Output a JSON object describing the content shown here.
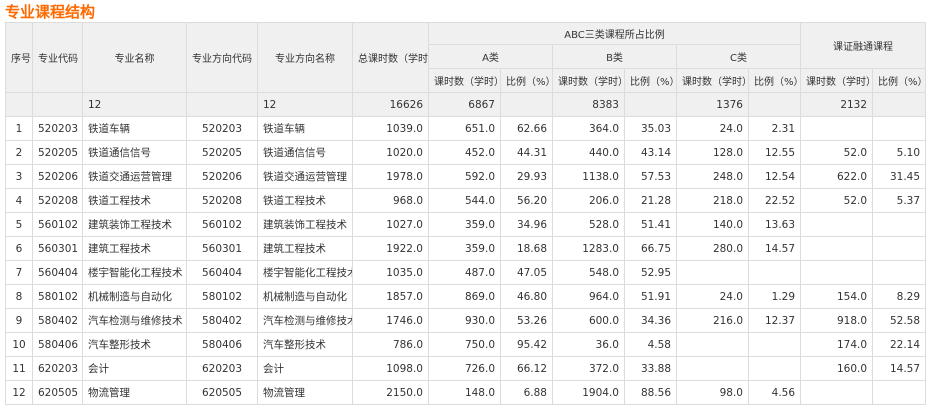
{
  "title": "专业课程结构",
  "header": {
    "seq": "序号",
    "major_code": "专业代码",
    "major_name": "专业名称",
    "dir_code": "专业方向代码",
    "dir_name": "专业方向名称",
    "total_hours": "总课时数（学时）",
    "abc_group": "ABC三类课程所占比例",
    "cert_group": "课证融通课程",
    "cat_a": "A类",
    "cat_b": "B类",
    "cat_c": "C类",
    "hours": "课时数（学时）",
    "ratio": "比例（%）"
  },
  "totals": {
    "major_name": "12",
    "dir_name": "12",
    "total_hours": "16626",
    "a_hours": "6867",
    "b_hours": "8383",
    "c_hours": "1376",
    "cert_hours": "2132"
  },
  "rows": [
    {
      "no": "1",
      "code": "520203",
      "name": "铁道车辆",
      "dcode": "520203",
      "dname": "铁道车辆",
      "total": "1039.0",
      "a_h": "651.0",
      "a_p": "62.66",
      "b_h": "364.0",
      "b_p": "35.03",
      "c_h": "24.0",
      "c_p": "2.31",
      "x_h": "",
      "x_p": ""
    },
    {
      "no": "2",
      "code": "520205",
      "name": "铁道通信信号",
      "dcode": "520205",
      "dname": "铁道通信信号",
      "total": "1020.0",
      "a_h": "452.0",
      "a_p": "44.31",
      "b_h": "440.0",
      "b_p": "43.14",
      "c_h": "128.0",
      "c_p": "12.55",
      "x_h": "52.0",
      "x_p": "5.10"
    },
    {
      "no": "3",
      "code": "520206",
      "name": "铁道交通运营管理",
      "dcode": "520206",
      "dname": "铁道交通运营管理",
      "total": "1978.0",
      "a_h": "592.0",
      "a_p": "29.93",
      "b_h": "1138.0",
      "b_p": "57.53",
      "c_h": "248.0",
      "c_p": "12.54",
      "x_h": "622.0",
      "x_p": "31.45"
    },
    {
      "no": "4",
      "code": "520208",
      "name": "铁道工程技术",
      "dcode": "520208",
      "dname": "铁道工程技术",
      "total": "968.0",
      "a_h": "544.0",
      "a_p": "56.20",
      "b_h": "206.0",
      "b_p": "21.28",
      "c_h": "218.0",
      "c_p": "22.52",
      "x_h": "52.0",
      "x_p": "5.37"
    },
    {
      "no": "5",
      "code": "560102",
      "name": "建筑装饰工程技术",
      "dcode": "560102",
      "dname": "建筑装饰工程技术",
      "total": "1027.0",
      "a_h": "359.0",
      "a_p": "34.96",
      "b_h": "528.0",
      "b_p": "51.41",
      "c_h": "140.0",
      "c_p": "13.63",
      "x_h": "",
      "x_p": ""
    },
    {
      "no": "6",
      "code": "560301",
      "name": "建筑工程技术",
      "dcode": "560301",
      "dname": "建筑工程技术",
      "total": "1922.0",
      "a_h": "359.0",
      "a_p": "18.68",
      "b_h": "1283.0",
      "b_p": "66.75",
      "c_h": "280.0",
      "c_p": "14.57",
      "x_h": "",
      "x_p": ""
    },
    {
      "no": "7",
      "code": "560404",
      "name": "楼宇智能化工程技术",
      "dcode": "560404",
      "dname": "楼宇智能化工程技术",
      "total": "1035.0",
      "a_h": "487.0",
      "a_p": "47.05",
      "b_h": "548.0",
      "b_p": "52.95",
      "c_h": "",
      "c_p": "",
      "x_h": "",
      "x_p": ""
    },
    {
      "no": "8",
      "code": "580102",
      "name": "机械制造与自动化",
      "dcode": "580102",
      "dname": "机械制造与自动化",
      "total": "1857.0",
      "a_h": "869.0",
      "a_p": "46.80",
      "b_h": "964.0",
      "b_p": "51.91",
      "c_h": "24.0",
      "c_p": "1.29",
      "x_h": "154.0",
      "x_p": "8.29"
    },
    {
      "no": "9",
      "code": "580402",
      "name": "汽车检测与维修技术",
      "dcode": "580402",
      "dname": "汽车检测与维修技术",
      "total": "1746.0",
      "a_h": "930.0",
      "a_p": "53.26",
      "b_h": "600.0",
      "b_p": "34.36",
      "c_h": "216.0",
      "c_p": "12.37",
      "x_h": "918.0",
      "x_p": "52.58"
    },
    {
      "no": "10",
      "code": "580406",
      "name": "汽车整形技术",
      "dcode": "580406",
      "dname": "汽车整形技术",
      "total": "786.0",
      "a_h": "750.0",
      "a_p": "95.42",
      "b_h": "36.0",
      "b_p": "4.58",
      "c_h": "",
      "c_p": "",
      "x_h": "174.0",
      "x_p": "22.14"
    },
    {
      "no": "11",
      "code": "620203",
      "name": "会计",
      "dcode": "620203",
      "dname": "会计",
      "total": "1098.0",
      "a_h": "726.0",
      "a_p": "66.12",
      "b_h": "372.0",
      "b_p": "33.88",
      "c_h": "",
      "c_p": "",
      "x_h": "160.0",
      "x_p": "14.57"
    },
    {
      "no": "12",
      "code": "620505",
      "name": "物流管理",
      "dcode": "620505",
      "dname": "物流管理",
      "total": "2150.0",
      "a_h": "148.0",
      "a_p": "6.88",
      "b_h": "1904.0",
      "b_p": "88.56",
      "c_h": "98.0",
      "c_p": "4.56",
      "x_h": "",
      "x_p": ""
    }
  ]
}
